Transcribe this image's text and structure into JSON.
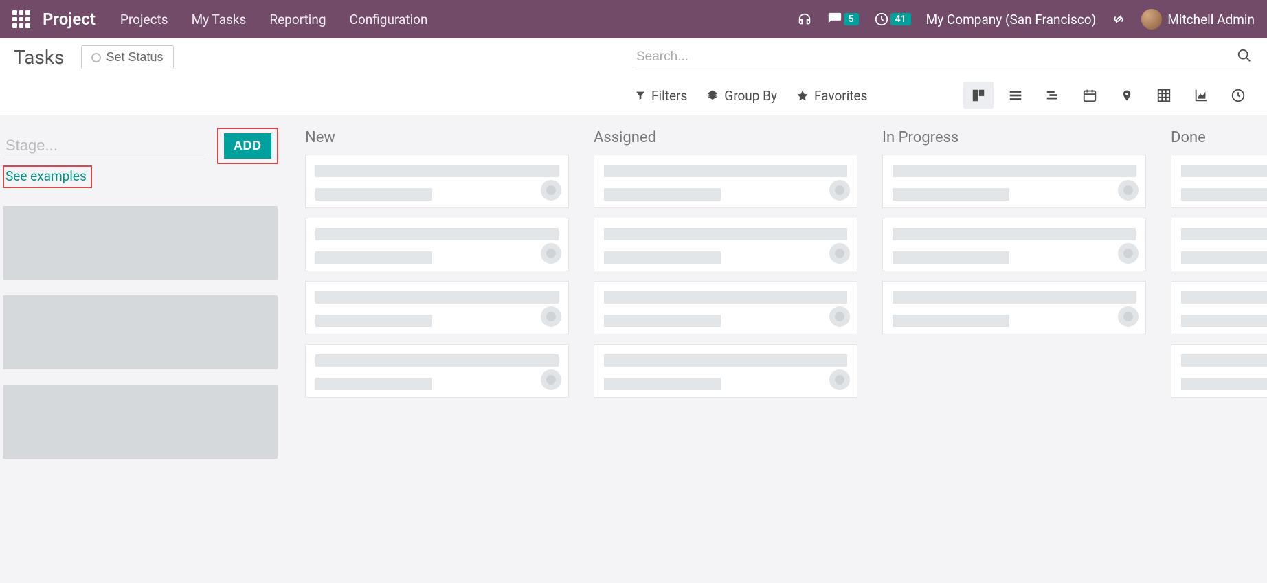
{
  "navbar": {
    "brand": "Project",
    "menu": [
      "Projects",
      "My Tasks",
      "Reporting",
      "Configuration"
    ],
    "messages_badge": "5",
    "activities_badge": "41",
    "company": "My Company (San Francisco)",
    "user": "Mitchell Admin"
  },
  "control_panel": {
    "title": "Tasks",
    "set_status": "Set Status",
    "search_placeholder": "Search...",
    "filters": "Filters",
    "group_by": "Group By",
    "favorites": "Favorites"
  },
  "kanban": {
    "stage_input_placeholder": "Stage...",
    "add_button": "ADD",
    "see_examples": "See examples",
    "columns": [
      {
        "title": "New",
        "card_count": 4,
        "avatars": true
      },
      {
        "title": "Assigned",
        "card_count": 4,
        "avatars": true
      },
      {
        "title": "In Progress",
        "card_count": 3,
        "avatars": true
      },
      {
        "title": "Done",
        "card_count": 4,
        "avatars": false
      }
    ]
  }
}
